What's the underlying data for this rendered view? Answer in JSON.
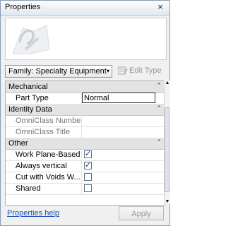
{
  "window": {
    "title": "Properties",
    "close_glyph": "×"
  },
  "preview": {
    "icon": "family-preview-thumbnail"
  },
  "type_selector": {
    "value": "Family: Specialty Equipment",
    "caret": "▾"
  },
  "edit_type": {
    "label": "Edit Type",
    "icon": "edit-type-icon"
  },
  "sections": {
    "mechanical": {
      "label": "Mechanical",
      "collapse_glyph": "⌃"
    },
    "identity": {
      "label": "Identity Data",
      "collapse_glyph": "⌃"
    },
    "other": {
      "label": "Other",
      "collapse_glyph": "⌃"
    }
  },
  "props": {
    "part_type": {
      "name": "Part Type",
      "value": "Normal"
    },
    "omniclass_number": {
      "name": "OmniClass Number"
    },
    "omniclass_title": {
      "name": "OmniClass Title"
    },
    "work_plane_based": {
      "name": "Work Plane-Based",
      "checked": true
    },
    "always_vertical": {
      "name": "Always vertical",
      "checked": true
    },
    "cut_with_voids": {
      "name": "Cut with Voids W...",
      "checked": false
    },
    "shared": {
      "name": "Shared",
      "checked": false
    }
  },
  "check_glyph": "✓",
  "footer": {
    "help_link": "Properties help",
    "apply_label": "Apply"
  },
  "colors": {
    "accent_link": "#1a4fb6",
    "header_bg": "#e3e3e3",
    "disabled_text": "#9a9a9a"
  }
}
